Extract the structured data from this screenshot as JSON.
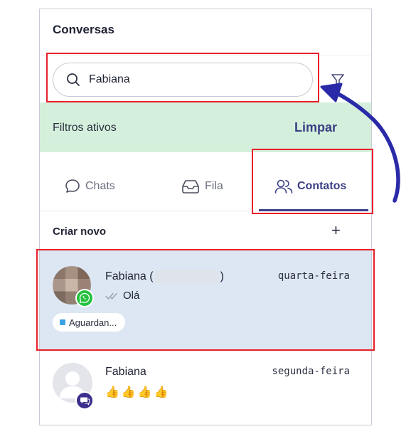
{
  "header": {
    "title": "Conversas"
  },
  "search": {
    "value": "Fabiana",
    "placeholder": ""
  },
  "filters": {
    "label": "Filtros ativos",
    "clear_label": "Limpar"
  },
  "tabs": [
    {
      "label": "Chats",
      "icon": "chat-bubble-icon",
      "active": false
    },
    {
      "label": "Fila",
      "icon": "inbox-tray-icon",
      "active": false
    },
    {
      "label": "Contatos",
      "icon": "users-icon",
      "active": true
    }
  ],
  "create": {
    "label": "Criar novo",
    "plus": "+"
  },
  "conversations": [
    {
      "name": "Fabiana",
      "name_suffix_open": " (",
      "name_suffix_close": ")",
      "day": "quarta-feira",
      "preview": "Olá",
      "channel_icon": "whatsapp-icon",
      "status_tag": "Aguardan...",
      "selected": true
    },
    {
      "name": "Fabiana",
      "day": "segunda-feira",
      "preview": "👍👍👍👍",
      "channel_icon": "chat-channel-icon",
      "selected": false
    }
  ],
  "colors": {
    "accent": "#3b3f84",
    "filters_bg": "#d4f0dc",
    "selected_bg": "#dde6f3",
    "highlight": "#e8202a",
    "whatsapp": "#25c13f"
  }
}
